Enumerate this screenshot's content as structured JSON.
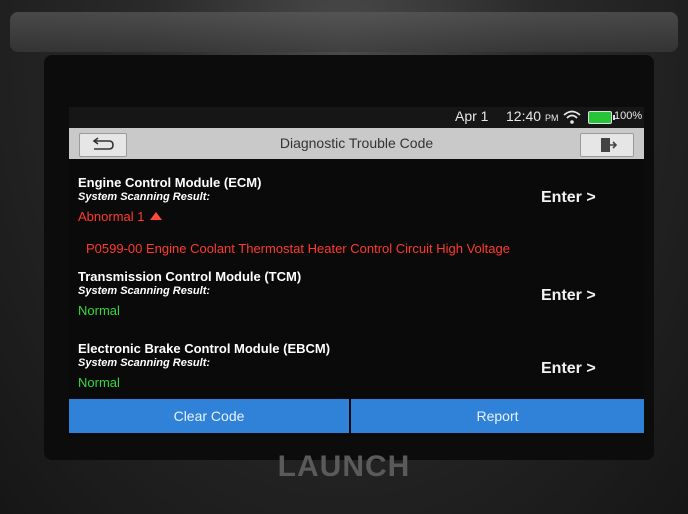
{
  "status_bar": {
    "date": "Apr 1",
    "time": "12:40",
    "ampm": "PM",
    "battery": "100%"
  },
  "header": {
    "title": "Diagnostic Trouble Code"
  },
  "modules": [
    {
      "name": "Engine Control Module (ECM)",
      "sub": "System Scanning Result:",
      "status": "Abnormal 1",
      "enter": "Enter >"
    },
    {
      "name": "Transmission Control Module (TCM)",
      "sub": "System Scanning Result:",
      "status": "Normal",
      "enter": "Enter >"
    },
    {
      "name": "Electronic Brake Control Module (EBCM)",
      "sub": "System Scanning Result:",
      "status": "Normal",
      "enter": "Enter >"
    }
  ],
  "dtc": {
    "text": "P0599-00 Engine Coolant Thermostat Heater Control Circuit High Voltage"
  },
  "actions": {
    "clear": "Clear Code",
    "report": "Report"
  },
  "brand": {
    "logo": "LAUNCH"
  },
  "colors": {
    "accent": "#2f82d8",
    "abnormal": "#ff3a2e",
    "normal": "#34d83b"
  }
}
